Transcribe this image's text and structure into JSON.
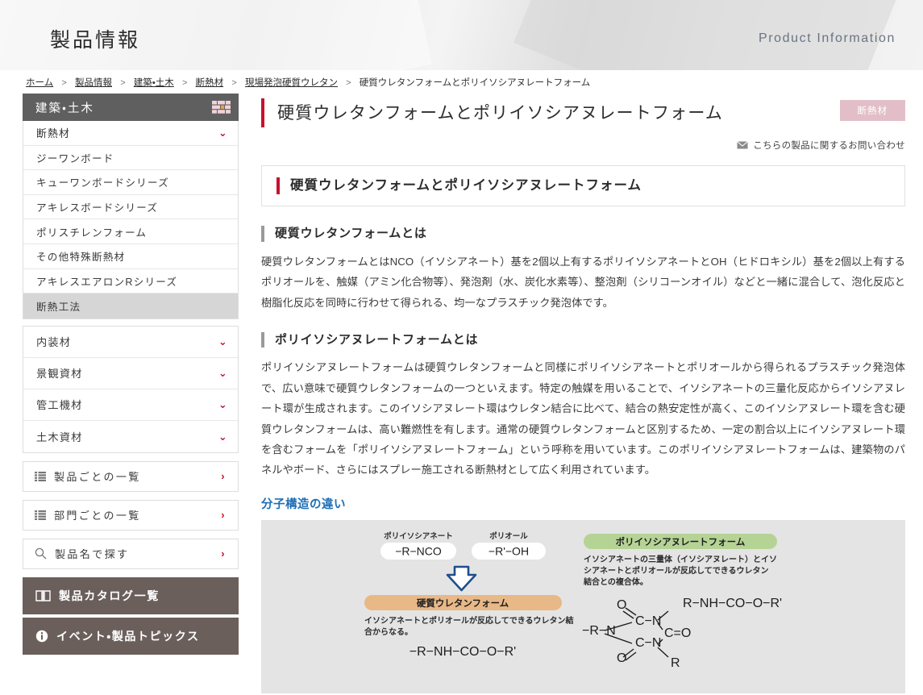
{
  "header": {
    "title": "製品情報",
    "subtitle": "Product Information"
  },
  "breadcrumb": {
    "items": [
      {
        "label": "ホーム",
        "link": true
      },
      {
        "label": "製品情報",
        "link": true
      },
      {
        "label": "建築・土木",
        "link": true
      },
      {
        "label": "断熱材",
        "link": true
      },
      {
        "label": "現場発泡硬質ウレタン",
        "link": true
      },
      {
        "label": "硬質ウレタンフォームとポリイソシアヌレートフォーム",
        "link": false
      }
    ],
    "separator": ">"
  },
  "sidebar": {
    "category_head": {
      "label": "建築・土木",
      "icon": "brick-wall-icon"
    },
    "nav_items": [
      {
        "label": "断熱材",
        "state": "active",
        "type": "parent",
        "chevron": "⌄"
      },
      {
        "label": "ジーワンボード",
        "state": "",
        "type": "sub"
      },
      {
        "label": "キューワンボードシリーズ",
        "state": "",
        "type": "sub"
      },
      {
        "label": "アキレスボードシリーズ",
        "state": "",
        "type": "sub"
      },
      {
        "label": "ポリスチレンフォーム",
        "state": "",
        "type": "sub"
      },
      {
        "label": "その他特殊断熱材",
        "state": "",
        "type": "sub"
      },
      {
        "label": "アキレスエアロンRシリーズ",
        "state": "",
        "type": "sub"
      },
      {
        "label": "断熱工法",
        "state": "active",
        "type": "sub"
      }
    ],
    "nav_groups": [
      {
        "label": "内装材",
        "chevron": "⌄"
      },
      {
        "label": "景観資材",
        "chevron": "⌄"
      },
      {
        "label": "管工機材",
        "chevron": "⌄"
      },
      {
        "label": "土木資材",
        "chevron": "⌄"
      }
    ],
    "link_boxes": [
      {
        "label": "製品ごとの一覧",
        "icon": "list-icon",
        "arrow": "›"
      },
      {
        "label": "部門ごとの一覧",
        "icon": "list-icon",
        "arrow": "›"
      },
      {
        "label": "製品名で探す",
        "icon": "search-icon",
        "arrow": "›"
      }
    ],
    "dark_buttons": [
      {
        "label": "製品カタログ一覧",
        "icon": "book-icon"
      },
      {
        "label": "イベント・製品トピックス",
        "icon": "info-icon"
      }
    ]
  },
  "main": {
    "page_title": "硬質ウレタンフォームとポリイソシアヌレートフォーム",
    "tag_badge": "断熱材",
    "contact_link": "こちらの製品に関するお問い合わせ",
    "section_heading": "硬質ウレタンフォームとポリイソシアヌレートフォーム",
    "subsections": [
      {
        "heading": "硬質ウレタンフォームとは",
        "body": "硬質ウレタンフォームとはNCO（イソシアネート）基を2個以上有するポリイソシアネートとOH（ヒドロキシル）基を2個以上有するポリオールを、触媒（アミン化合物等）、発泡剤（水、炭化水素等）、整泡剤（シリコーンオイル）などと一緒に混合して、泡化反応と樹脂化反応を同時に行わせて得られる、均一なプラスチック発泡体です。"
      },
      {
        "heading": "ポリイソシアヌレートフォームとは",
        "body": "ポリイソシアヌレートフォームは硬質ウレタンフォームと同様にポリイソシアネートとポリオールから得られるプラスチック発泡体で、広い意味で硬質ウレタンフォームの一つといえます。特定の触媒を用いることで、イソシアネートの三量化反応からイソシアヌレート環が生成されます。このイソシアヌレート環はウレタン結合に比べて、結合の熱安定性が高く、このイソシアヌレート環を含む硬質ウレタンフォームは、高い難燃性を有します。通常の硬質ウレタンフォームと区別するため、一定の割合以上にイソシアヌレート環を含むフォームを「ポリイソシアヌレートフォーム」という呼称を用いています。このポリイソシアヌレートフォームは、建築物のパネルやボード、さらにはスプレー施工される断熱材として広く利用されています。"
      }
    ],
    "diagram": {
      "title": "分子構造の違い",
      "left": {
        "reactant1_label": "ポリイソシアネート",
        "reactant1_formula": "−R−NCO",
        "reactant2_label": "ポリオール",
        "reactant2_formula": "−R'−OH",
        "arrow": "down-arrow-icon",
        "product_label": "硬質ウレタンフォーム",
        "product_desc": "イソシアネートとポリオールが反応してできるウレタン結合からなる。",
        "product_formula": "−R−NH−CO−O−R'"
      },
      "right": {
        "product_label": "ポリイソシアヌレートフォーム",
        "product_desc": "イソシアネートの三量体（イソシアヌレート）とイソシアネートとポリオールが反応してできるウレタン結合との複合体。",
        "ring_atoms": {
          "top_chain": "R−NH−CO−O−R'",
          "left_chain": "−R−N",
          "c_top": "C−N",
          "c_bottom": "C−N",
          "c_right": "C=O",
          "o_top": "O",
          "o_bottom": "O",
          "r_bottom": "R"
        }
      }
    }
  },
  "colors": {
    "accent_red": "#c8102e",
    "badge_pink": "#e2bfc8",
    "dark_brown": "#6b5f5c",
    "header_gray": "#5f5f5f",
    "diagram_blue": "#1f6fb5",
    "product_orange": "#e8b887",
    "product_green": "#b6d396",
    "arrow_navy": "#1f4e8c"
  }
}
